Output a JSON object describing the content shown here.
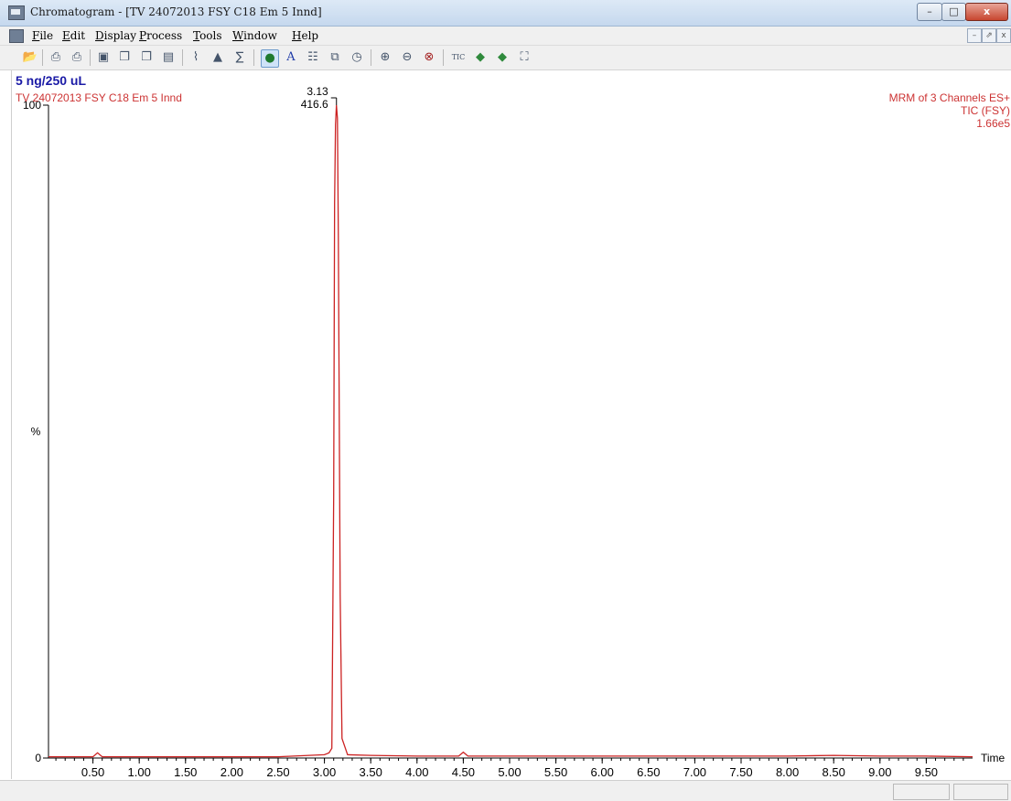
{
  "window": {
    "title": "Chromatogram - [TV 24072013 FSY C18 Em 5 Innd]",
    "controls": {
      "minimize": "–",
      "maximize": "□",
      "close": "x"
    }
  },
  "menu": {
    "items": [
      "File",
      "Edit",
      "Display",
      "Process",
      "Tools",
      "Window",
      "Help"
    ],
    "mdi_controls": [
      "–",
      "⇗",
      "x"
    ]
  },
  "toolbar": {
    "icons": [
      "open-icon",
      "print-icon",
      "print-preview-icon",
      "camera-icon",
      "copy-icon",
      "copy-list-icon",
      "paste-icon",
      "chromatogram-icon",
      "peak-detect-icon",
      "integrate-icon",
      "globe-icon",
      "font-icon",
      "library-icon",
      "combine-icon",
      "timer-icon",
      "zoom-in-icon",
      "zoom-out-icon",
      "zoom-reset-icon",
      "tic-button",
      "back-arrow-icon",
      "forward-arrow-icon",
      "fit-icon"
    ],
    "tic_label": "TIC"
  },
  "colors": {
    "trace": "#cc2222",
    "header_blue": "#1a1aa6",
    "header_red": "#cc3333",
    "axis": "#000000"
  },
  "header": {
    "sample": "5 ng/250 uL",
    "file": "TV 24072013 FSY C18 Em 5 Innd",
    "right_lines": [
      "MRM of 3 Channels ES+",
      "TIC (FSY)",
      "1.66e5"
    ]
  },
  "chart_data": {
    "type": "line",
    "xlabel": "Time",
    "ylabel": "%",
    "xlim": [
      0.02,
      10.0
    ],
    "ylim": [
      0,
      100
    ],
    "xticks": [
      "0.50",
      "1.00",
      "1.50",
      "2.00",
      "2.50",
      "3.00",
      "3.50",
      "4.00",
      "4.50",
      "5.00",
      "5.50",
      "6.00",
      "6.50",
      "7.00",
      "7.50",
      "8.00",
      "8.50",
      "9.00",
      "9.50"
    ],
    "yticks": [
      "0",
      "100"
    ],
    "series": [
      {
        "x": [
          0.02,
          0.5,
          0.55,
          0.6,
          1.5,
          2.5,
          3.0,
          3.05,
          3.08,
          3.1,
          3.11,
          3.12,
          3.13,
          3.14,
          3.15,
          3.17,
          3.19,
          3.25,
          3.5,
          4.0,
          4.45,
          4.5,
          4.55,
          5.0,
          6.0,
          7.0,
          8.0,
          8.5,
          9.0,
          9.5,
          10.0
        ],
        "y": [
          0.2,
          0.2,
          0.8,
          0.2,
          0.2,
          0.2,
          0.5,
          0.8,
          1.5,
          40,
          85,
          97,
          100,
          98,
          80,
          25,
          3,
          0.5,
          0.4,
          0.3,
          0.3,
          0.9,
          0.3,
          0.3,
          0.3,
          0.3,
          0.3,
          0.4,
          0.3,
          0.3,
          0.2
        ]
      }
    ],
    "annotations": [
      {
        "x": 3.13,
        "y": 100,
        "lines": [
          "3.13",
          "416.6"
        ]
      }
    ]
  }
}
